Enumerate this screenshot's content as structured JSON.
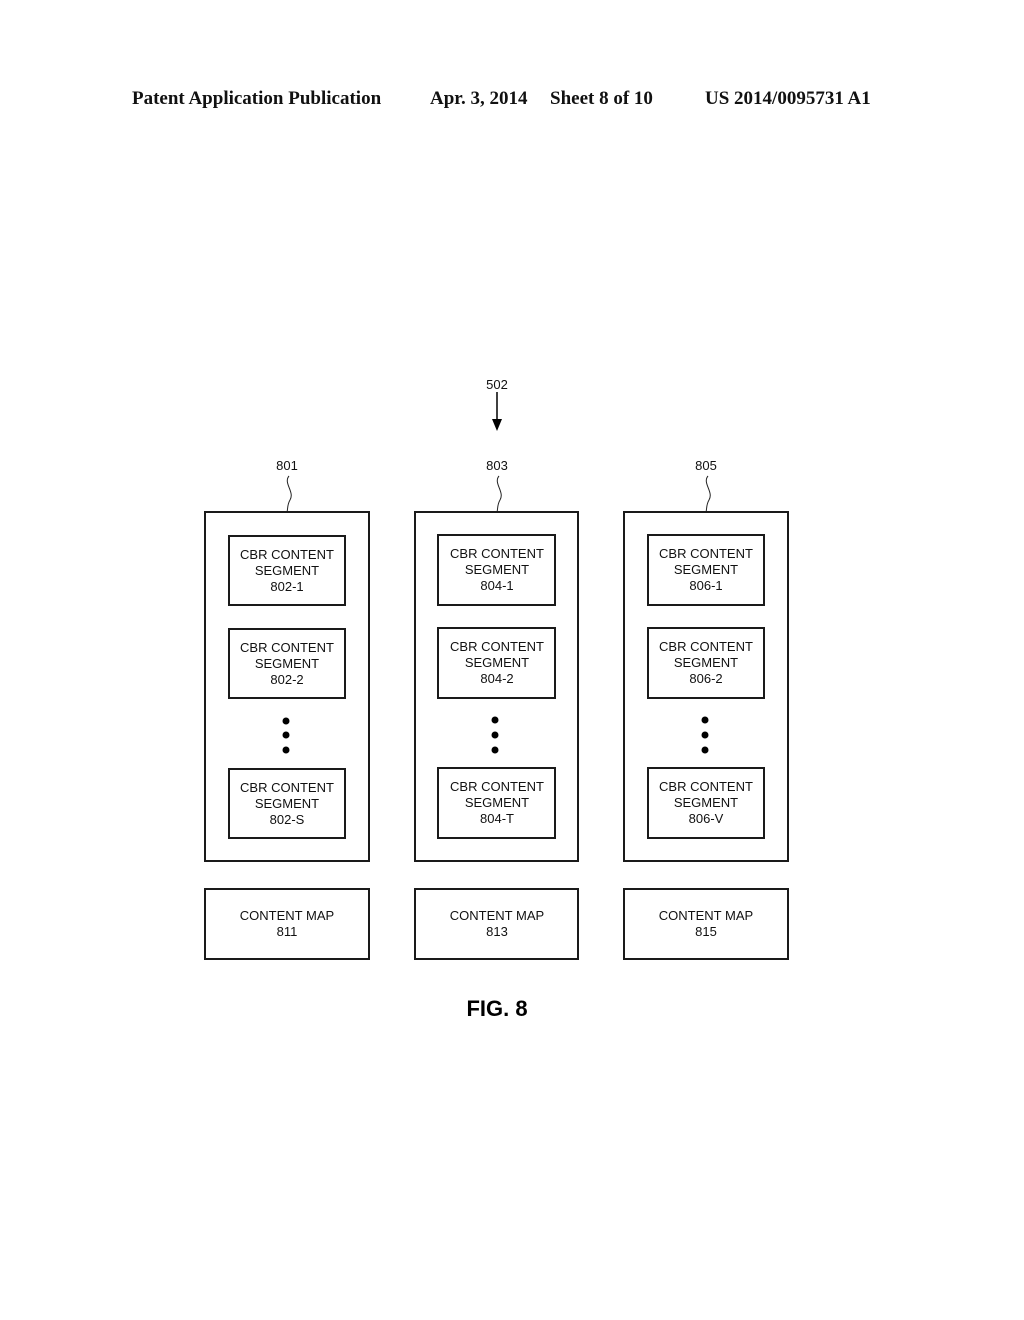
{
  "header": {
    "publication": "Patent Application Publication",
    "date": "Apr. 3, 2014",
    "sheet": "Sheet 8 of 10",
    "number": "US 2014/0095731 A1"
  },
  "figure": {
    "input_ref": "502",
    "caption": "FIG. 8",
    "columns": [
      {
        "ref": "801",
        "segments": [
          {
            "line1": "CBR CONTENT",
            "line2": "SEGMENT",
            "id": "802-1"
          },
          {
            "line1": "CBR CONTENT",
            "line2": "SEGMENT",
            "id": "802-2"
          },
          {
            "line1": "CBR CONTENT",
            "line2": "SEGMENT",
            "id": "802-S"
          }
        ],
        "map": {
          "line1": "CONTENT MAP",
          "id": "811"
        }
      },
      {
        "ref": "803",
        "segments": [
          {
            "line1": "CBR CONTENT",
            "line2": "SEGMENT",
            "id": "804-1"
          },
          {
            "line1": "CBR CONTENT",
            "line2": "SEGMENT",
            "id": "804-2"
          },
          {
            "line1": "CBR CONTENT",
            "line2": "SEGMENT",
            "id": "804-T"
          }
        ],
        "map": {
          "line1": "CONTENT MAP",
          "id": "813"
        }
      },
      {
        "ref": "805",
        "segments": [
          {
            "line1": "CBR CONTENT",
            "line2": "SEGMENT",
            "id": "806-1"
          },
          {
            "line1": "CBR CONTENT",
            "line2": "SEGMENT",
            "id": "806-2"
          },
          {
            "line1": "CBR CONTENT",
            "line2": "SEGMENT",
            "id": "806-V"
          }
        ],
        "map": {
          "line1": "CONTENT MAP",
          "id": "815"
        }
      }
    ]
  }
}
